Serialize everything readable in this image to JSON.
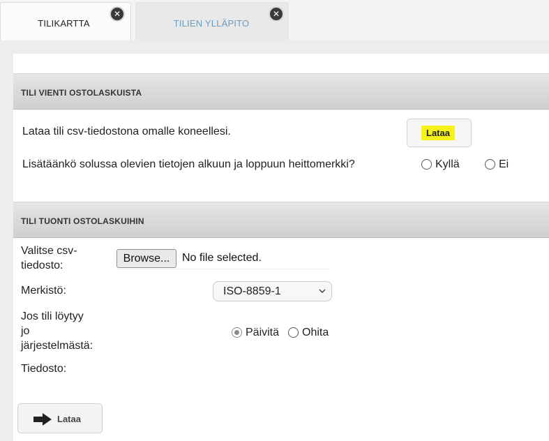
{
  "tabs": [
    {
      "label": "TILIKARTTA",
      "close": "✕"
    },
    {
      "label": "TILIEN YLLÄPITO",
      "close": "✕"
    }
  ],
  "export_section": {
    "title": "TILI VIENTI OSTOLASKUISTA",
    "description": "Lataa tili csv-tiedostona omalle koneellesi.",
    "download_label": "Lataa",
    "quote_question": "Lisätäänkö solussa olevien tietojen alkuun ja loppuun heittomerkki?",
    "option_yes": "Kyllä",
    "option_no": "Ei"
  },
  "import_section": {
    "title": "TILI TUONTI OSTOLASKUIHIN",
    "file_label_line1": "Valitse csv-",
    "file_label_line2": "tiedosto:",
    "browse_label": "Browse...",
    "no_file_text": "No file selected.",
    "charset_label": "Merkistö:",
    "charset_value": "ISO-8859-1",
    "exists_line1": "Jos tili löytyy",
    "exists_line2": "jo",
    "exists_line3": "järjestelmästä:",
    "option_update": "Päivitä",
    "option_skip": "Ohita",
    "update_checked": true,
    "file_result_label": "Tiedosto:",
    "submit_label": "Lataa"
  },
  "colors": {
    "highlight": "#f6f319",
    "active_tab_text": "#6b9bbf"
  }
}
